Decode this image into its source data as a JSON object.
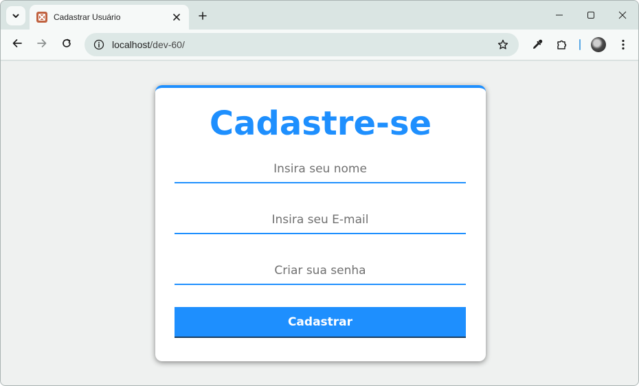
{
  "browser": {
    "tab": {
      "title": "Cadastrar Usuário",
      "favicon": "xampp-icon"
    },
    "url": {
      "host": "localhost",
      "path": "/dev-60/"
    }
  },
  "form": {
    "title": "Cadastre-se",
    "name_placeholder": "Insira seu nome",
    "email_placeholder": "Insira seu E-mail",
    "password_placeholder": "Criar sua senha",
    "submit_label": "Cadastrar"
  },
  "colors": {
    "accent": "#1e8ffe",
    "page_background": "#eff1f0",
    "card_background": "#ffffff"
  }
}
